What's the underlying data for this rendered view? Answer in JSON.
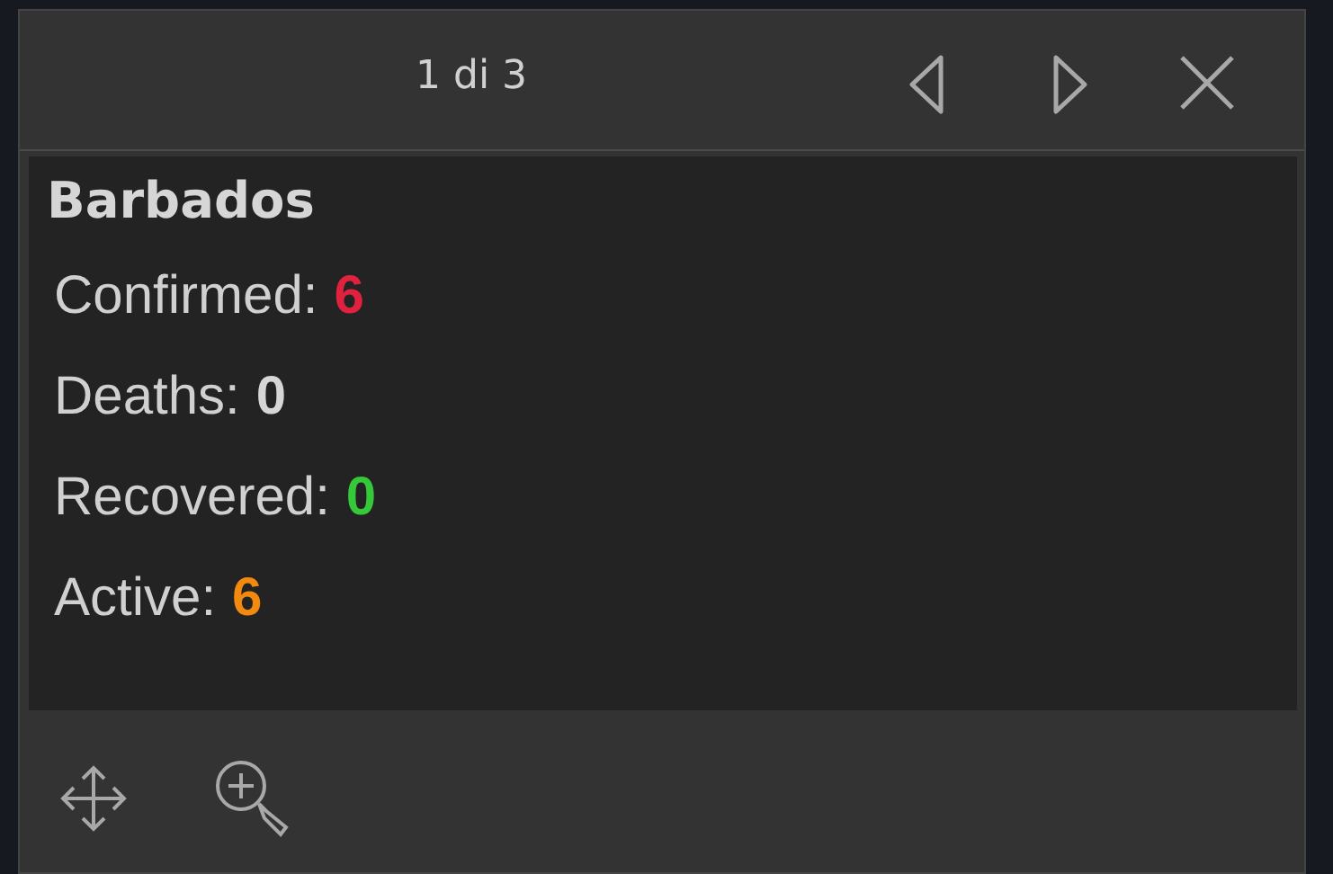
{
  "pager": {
    "label": "1 di 3"
  },
  "feature": {
    "title": "Barbados",
    "stats": [
      {
        "label": "Confirmed:",
        "value": "6",
        "color": "#e0223f"
      },
      {
        "label": "Deaths:",
        "value": "0",
        "color": "#d6d6d6"
      },
      {
        "label": "Recovered:",
        "value": "0",
        "color": "#35c93a"
      },
      {
        "label": "Active:",
        "value": "6",
        "color": "#f28a0f"
      }
    ]
  }
}
